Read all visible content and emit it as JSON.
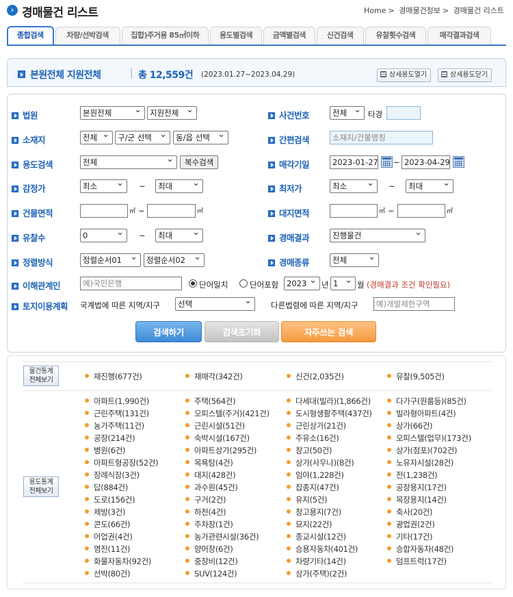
{
  "header": {
    "title": "경매물건 리스트",
    "breadcrumb": [
      "Home",
      "경매물건정보",
      "경매물건 리스트"
    ]
  },
  "tabs": [
    "종합검색",
    "차량/선박검색",
    "집합)주거용 85㎡이하",
    "용도별검색",
    "금액별검색",
    "신건검색",
    "유찰횟수검색",
    "매각결과검색"
  ],
  "summary": {
    "scope": "본원전체  지원전체",
    "total": "총 12,559건",
    "period": "(2023.01.27~2023.04.29)",
    "open_label": "상세용도열기",
    "close_label": "상세용도닫기"
  },
  "form": {
    "court": {
      "label": "법원",
      "court_value": "본원전체",
      "branch_value": "지원전체"
    },
    "case_no": {
      "label": "사건번호",
      "year_value": "전체",
      "suffix": "타경",
      "number_value": ""
    },
    "location": {
      "label": "소재지",
      "sido": "전체",
      "gugun": "구/군 선택",
      "dong": "동/읍 선택"
    },
    "simple": {
      "label": "간편검색",
      "placeholder": "소재지/건물명칭"
    },
    "usage": {
      "label": "용도검색",
      "value": "전체",
      "multi_label": "복수검색"
    },
    "sale_date": {
      "label": "매각기일",
      "from": "2023-01-27",
      "tilde": "~",
      "to": "2023-04-29"
    },
    "appraisal": {
      "label": "감정가",
      "min": "최소",
      "tilde": "~",
      "max": "최대"
    },
    "min_price": {
      "label": "최저가",
      "min": "최소",
      "tilde": "~",
      "max": "최대"
    },
    "building_area": {
      "label": "건물면적",
      "unit": "㎡",
      "sep": "~"
    },
    "land_area": {
      "label": "대지면적",
      "unit": "㎡",
      "sep": "~"
    },
    "fail_count": {
      "label": "유찰수",
      "min": "0",
      "tilde": "~",
      "max": "최대"
    },
    "result": {
      "label": "경매결과",
      "value": "진행물건"
    },
    "sort": {
      "label": "정렬방식",
      "first": "정렬순서01",
      "second": "정렬순서02"
    },
    "kind": {
      "label": "경매종류",
      "value": "전체"
    },
    "party": {
      "label": "이해관계인",
      "placeholder": "예)국민은행",
      "exact": "단어일치",
      "contains": "단어포함",
      "year": "2023",
      "year_suffix": "년",
      "month": "1",
      "month_suffix": "월",
      "note": "(경매결과 조건 확인필요)"
    },
    "land_plan": {
      "label": "토지이용계획",
      "national_text": "국계법에 따른 지역/지구",
      "national_value": "선택",
      "other_text": "다른법령에 따른 지역/지구",
      "other_placeholder": "예)개발제한구역"
    },
    "buttons": {
      "search": "검색하기",
      "reset": "검색초기화",
      "favorite": "자주쓰는 검색"
    }
  },
  "stats": {
    "item_stats_button": [
      "물건통계",
      "전체보기"
    ],
    "usage_stats_button": [
      "용도통계",
      "전체보기"
    ],
    "summary_items": [
      "재진행(677건)",
      "재매각(342건)",
      "신건(2,035건)",
      "유찰(9,505건)"
    ],
    "usage_items": [
      [
        "아파트(1,990건)",
        "주택(564건)",
        "다세대(빌라)(1,866건)",
        "다가구(원룸등)(85건)"
      ],
      [
        "근린주택(131건)",
        "오피스텔(주거)(421건)",
        "도시형생활주택(437건)",
        "빌라형아파트(4건)"
      ],
      [
        "농가주택(11건)",
        "근린시설(51건)",
        "근린상가(21건)",
        "상가(66건)"
      ],
      [
        "공장(214건)",
        "숙박시설(167건)",
        "주유소(16건)",
        "오피스텔(업무)(173건)"
      ],
      [
        "병원(6건)",
        "아파트상가(295건)",
        "창고(50건)",
        "상가(점포)(702건)"
      ],
      [
        "아파트형공장(52건)",
        "목욕탕(4건)",
        "상가(사우나)(8건)",
        "노유자시설(28건)"
      ],
      [
        "장례식장(3건)",
        "대지(428건)",
        "임야(1,228건)",
        "전(1,238건)"
      ],
      [
        "답(884건)",
        "과수원(45건)",
        "잡종지(47건)",
        "공장용지(17건)"
      ],
      [
        "도로(156건)",
        "구거(2건)",
        "유지(5건)",
        "목장용지(14건)"
      ],
      [
        "제방(3건)",
        "하천(4건)",
        "창고용지(7건)",
        "축사(20건)"
      ],
      [
        "콘도(66건)",
        "주차장(1건)",
        "묘지(22건)",
        "광업권(2건)"
      ],
      [
        "어업권(4건)",
        "농가관련시설(36건)",
        "종교시설(12건)",
        "기타(17건)"
      ],
      [
        "염전(11건)",
        "양어장(6건)",
        "승용자동차(401건)",
        "승합자동차(48건)"
      ],
      [
        "화물자동차(92건)",
        "중장비(12건)",
        "차량기타(14건)",
        "덤프트럭(17건)"
      ],
      [
        "선박(80건)",
        "SUV(124건)",
        "상가(주택)(2건)",
        ""
      ]
    ]
  }
}
